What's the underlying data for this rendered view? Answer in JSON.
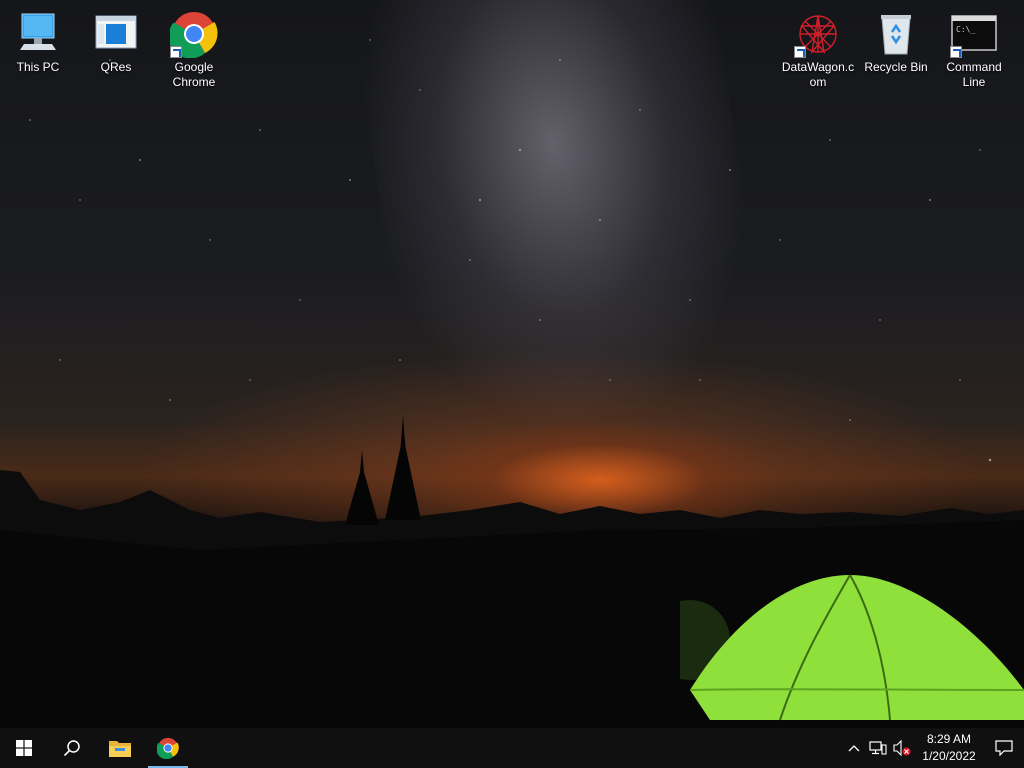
{
  "desktop": {
    "icons_left": [
      {
        "label": "This PC",
        "icon": "this-pc-icon"
      },
      {
        "label": "QRes",
        "icon": "qres-icon"
      },
      {
        "label": "Google Chrome",
        "icon": "chrome-icon"
      }
    ],
    "icons_right": [
      {
        "label": "DataWagon.com",
        "icon": "datawagon-icon"
      },
      {
        "label": "Recycle Bin",
        "icon": "recycle-bin-icon"
      },
      {
        "label": "Command Line",
        "icon": "command-line-icon"
      }
    ]
  },
  "taskbar": {
    "start_icon": "windows-start-icon",
    "search_icon": "search-icon",
    "pinned": [
      {
        "name": "File Explorer",
        "icon": "file-explorer-icon"
      },
      {
        "name": "Google Chrome",
        "icon": "chrome-icon",
        "active": true
      }
    ],
    "tray": {
      "chevron_icon": "chevron-up-icon",
      "network_icon": "network-icon",
      "volume_icon": "volume-muted-icon",
      "time": "8:29 AM",
      "date": "1/20/2022",
      "notification_icon": "action-center-icon"
    }
  },
  "colors": {
    "taskbar_bg": "#101010",
    "accent": "#76b9ed",
    "tent_green": "#8fe03a"
  }
}
